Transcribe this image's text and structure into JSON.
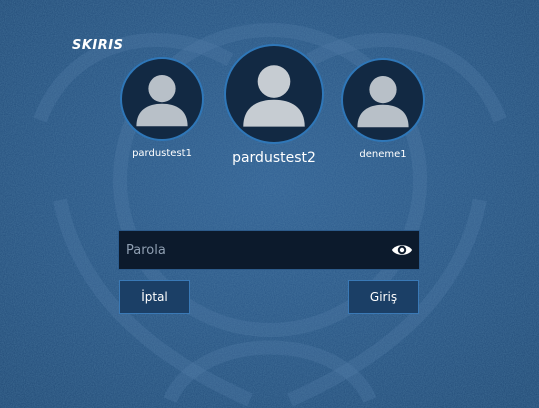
{
  "screen": {
    "title": "SKIRIS"
  },
  "users": [
    {
      "name": "pardustest1",
      "icon": "user-silhouette-icon"
    },
    {
      "name": "pardustest2",
      "icon": "user-silhouette-icon"
    },
    {
      "name": "deneme1",
      "icon": "user-silhouette-icon"
    }
  ],
  "password": {
    "placeholder": "Parola",
    "value": "",
    "toggle_icon": "eye-icon"
  },
  "buttons": {
    "cancel_label": "İptal",
    "login_label": "Giriş"
  },
  "colors": {
    "background": "#2a5585",
    "avatar_ring": "#2f77b8",
    "input_background": "#0c1a2c",
    "button_background": "#1b3f66"
  }
}
